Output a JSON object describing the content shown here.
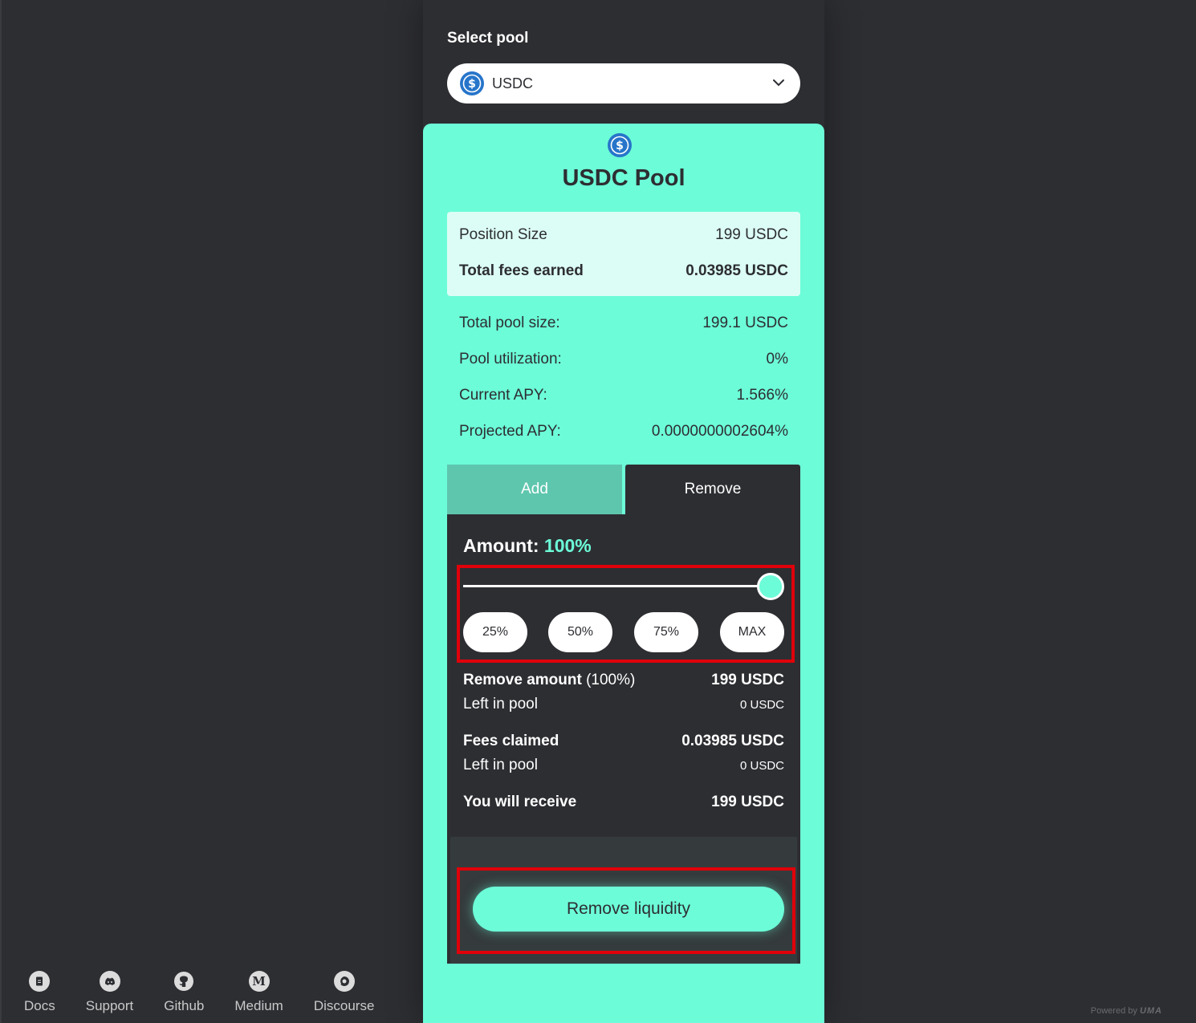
{
  "select_pool": {
    "label": "Select pool",
    "selected": "USDC",
    "token_icon": "usdc-coin-icon",
    "chevron_icon": "chevron-down-icon"
  },
  "pool_card": {
    "title": "USDC Pool",
    "position": {
      "size_label": "Position Size",
      "size_value": "199 USDC",
      "fees_label": "Total fees earned",
      "fees_value": "0.03985 USDC"
    },
    "stats": [
      {
        "label": "Total pool size:",
        "value": "199.1 USDC"
      },
      {
        "label": "Pool utilization:",
        "value": "0%"
      },
      {
        "label": "Current APY:",
        "value": "1.566%"
      },
      {
        "label": "Projected APY:",
        "value": "0.0000000002604%"
      }
    ],
    "tabs": {
      "add": "Add",
      "remove": "Remove",
      "active": "Remove"
    }
  },
  "remove_panel": {
    "amount_label": "Amount:",
    "amount_pct": "100%",
    "slider_fraction": 1.0,
    "presets": [
      "25%",
      "50%",
      "75%",
      "MAX"
    ],
    "remove_amount_label": "Remove amount",
    "remove_amount_pct": "(100%)",
    "remove_amount_value": "199 USDC",
    "left_in_pool_label": "Left in pool",
    "left_in_pool_value": "0 USDC",
    "fees_claimed_label": "Fees claimed",
    "fees_claimed_value": "0.03985 USDC",
    "fees_left_label": "Left in pool",
    "fees_left_value": "0 USDC",
    "receive_label": "You will receive",
    "receive_value": "199 USDC",
    "button": "Remove liquidity"
  },
  "footer": {
    "links": [
      {
        "label": "Docs",
        "icon": "docs-icon"
      },
      {
        "label": "Support",
        "icon": "discord-icon"
      },
      {
        "label": "Github",
        "icon": "github-icon"
      },
      {
        "label": "Medium",
        "icon": "medium-icon"
      },
      {
        "label": "Discourse",
        "icon": "discourse-icon"
      }
    ],
    "powered_by": "Powered by",
    "brand": "UMA"
  },
  "colors": {
    "background": "#2d2e32",
    "accent": "#6cfcd8",
    "highlight": "#e0000a"
  }
}
